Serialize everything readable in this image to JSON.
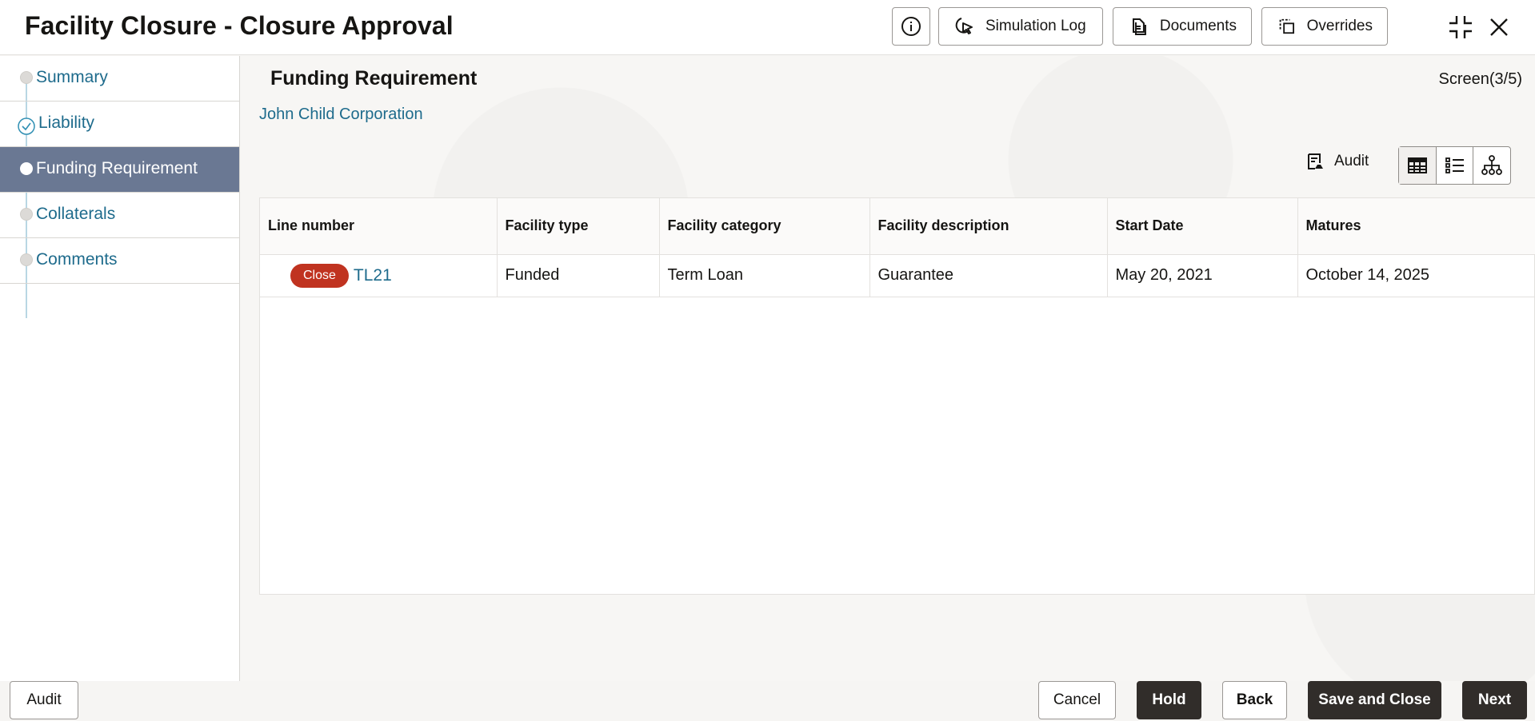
{
  "header": {
    "title": "Facility Closure - Closure Approval",
    "buttons": {
      "simulation_log": "Simulation Log",
      "documents": "Documents",
      "overrides": "Overrides"
    }
  },
  "sidebar": {
    "items": [
      {
        "label": "Summary",
        "state": "default"
      },
      {
        "label": "Liability",
        "state": "completed"
      },
      {
        "label": "Funding Requirement",
        "state": "active"
      },
      {
        "label": "Collaterals",
        "state": "default"
      },
      {
        "label": "Comments",
        "state": "default"
      }
    ]
  },
  "main": {
    "section_title": "Funding Requirement",
    "screen_counter": "Screen(3/5)",
    "customer": "John Child Corporation",
    "audit_label": "Audit",
    "table": {
      "headers": [
        "Line number",
        "Facility type",
        "Facility category",
        "Facility description",
        "Start Date",
        "Matures"
      ],
      "rows": [
        {
          "badge": "Close",
          "line_number": "TL21",
          "facility_type": "Funded",
          "facility_category": "Term Loan",
          "facility_description": "Guarantee",
          "start_date": "May 20, 2021",
          "matures": "October 14, 2025"
        }
      ]
    }
  },
  "footer": {
    "audit": "Audit",
    "cancel": "Cancel",
    "hold": "Hold",
    "back": "Back",
    "save_and_close": "Save and Close",
    "next": "Next"
  },
  "colors": {
    "accent_link": "#1e6b8c",
    "active_nav": "#6a7893",
    "badge_close": "#c03320",
    "dark_button": "#312d2a"
  }
}
